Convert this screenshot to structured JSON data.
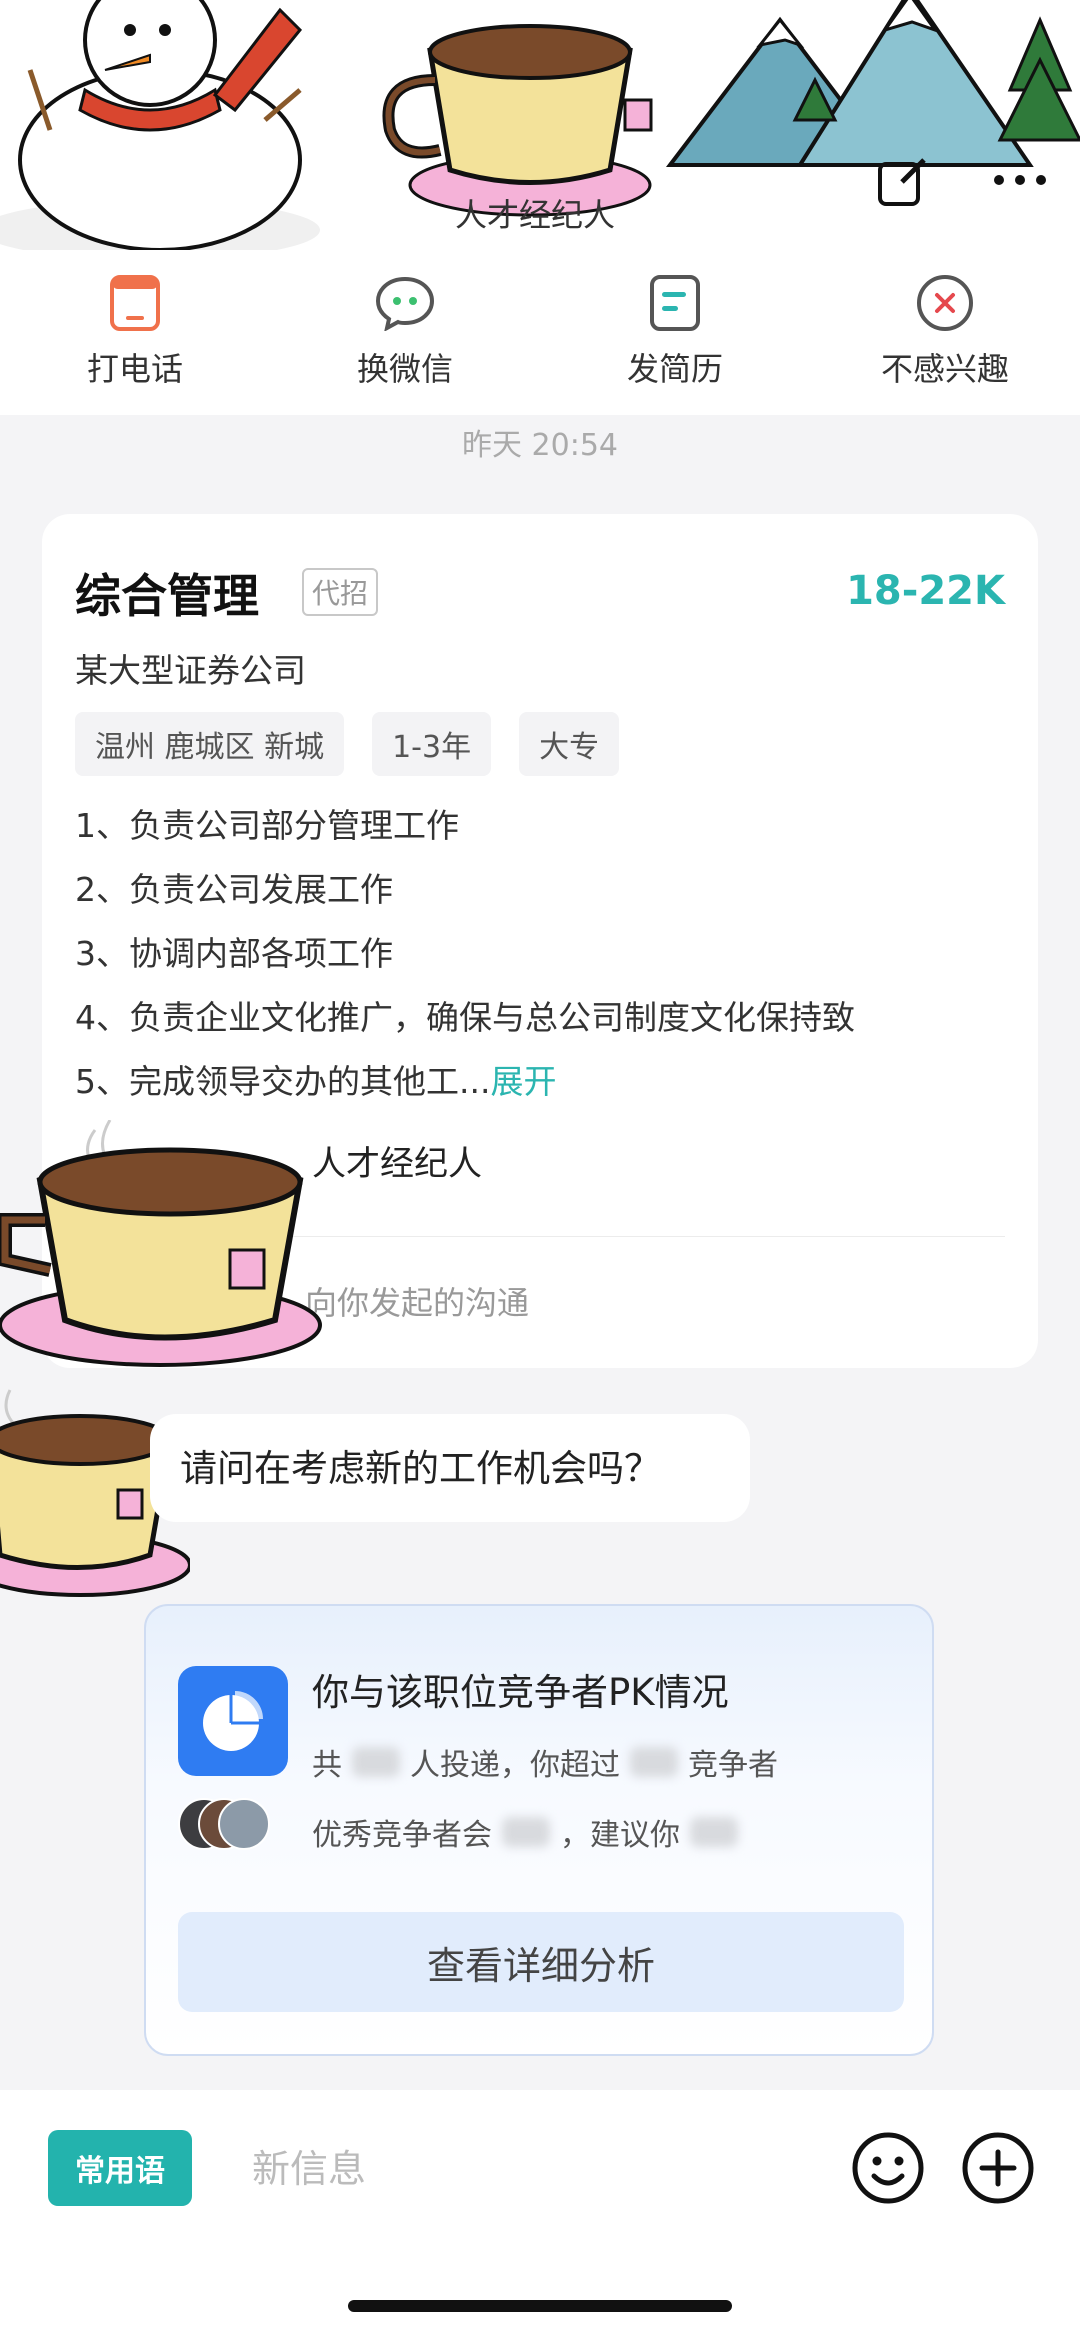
{
  "header": {
    "title": "人才经纪人"
  },
  "actions": [
    {
      "label": "打电话",
      "icon": "phone-icon"
    },
    {
      "label": "换微信",
      "icon": "wechat-icon"
    },
    {
      "label": "发简历",
      "icon": "resume-icon"
    },
    {
      "label": "不感兴趣",
      "icon": "not-interested-icon"
    }
  ],
  "timestamp": "昨天 20:54",
  "job": {
    "title": "综合管理",
    "tag": "代招",
    "salary": "18-22K",
    "company": "某大型证券公司",
    "tags": [
      "温州 鹿城区 新城",
      "1-3年",
      "大专"
    ],
    "description": [
      "1、负责公司部分管理工作",
      "2、负责公司发展工作",
      "3、协调内部各项工作",
      "4、负责企业文化推广，确保与总公司制度文化保持致",
      "5、完成领导交办的其他工..."
    ],
    "expand_label": "展开",
    "recruiter": "人才经纪人",
    "initiator_text": "向你发起的沟通"
  },
  "message": {
    "text": "请问在考虑新的工作机会吗？"
  },
  "pk": {
    "title": "你与该职位竞争者PK情况",
    "line1_prefix": "共",
    "line1_middle": "人投递，你超过",
    "line1_suffix": "竞争者",
    "line2_prefix": "优秀竞争者会",
    "line2_middle": "，建议你",
    "button_label": "查看详细分析"
  },
  "input": {
    "phrase_button": "常用语",
    "placeholder": "新信息"
  },
  "colors": {
    "accent": "#2bb5b0",
    "pk_blue": "#2f7cf2"
  }
}
